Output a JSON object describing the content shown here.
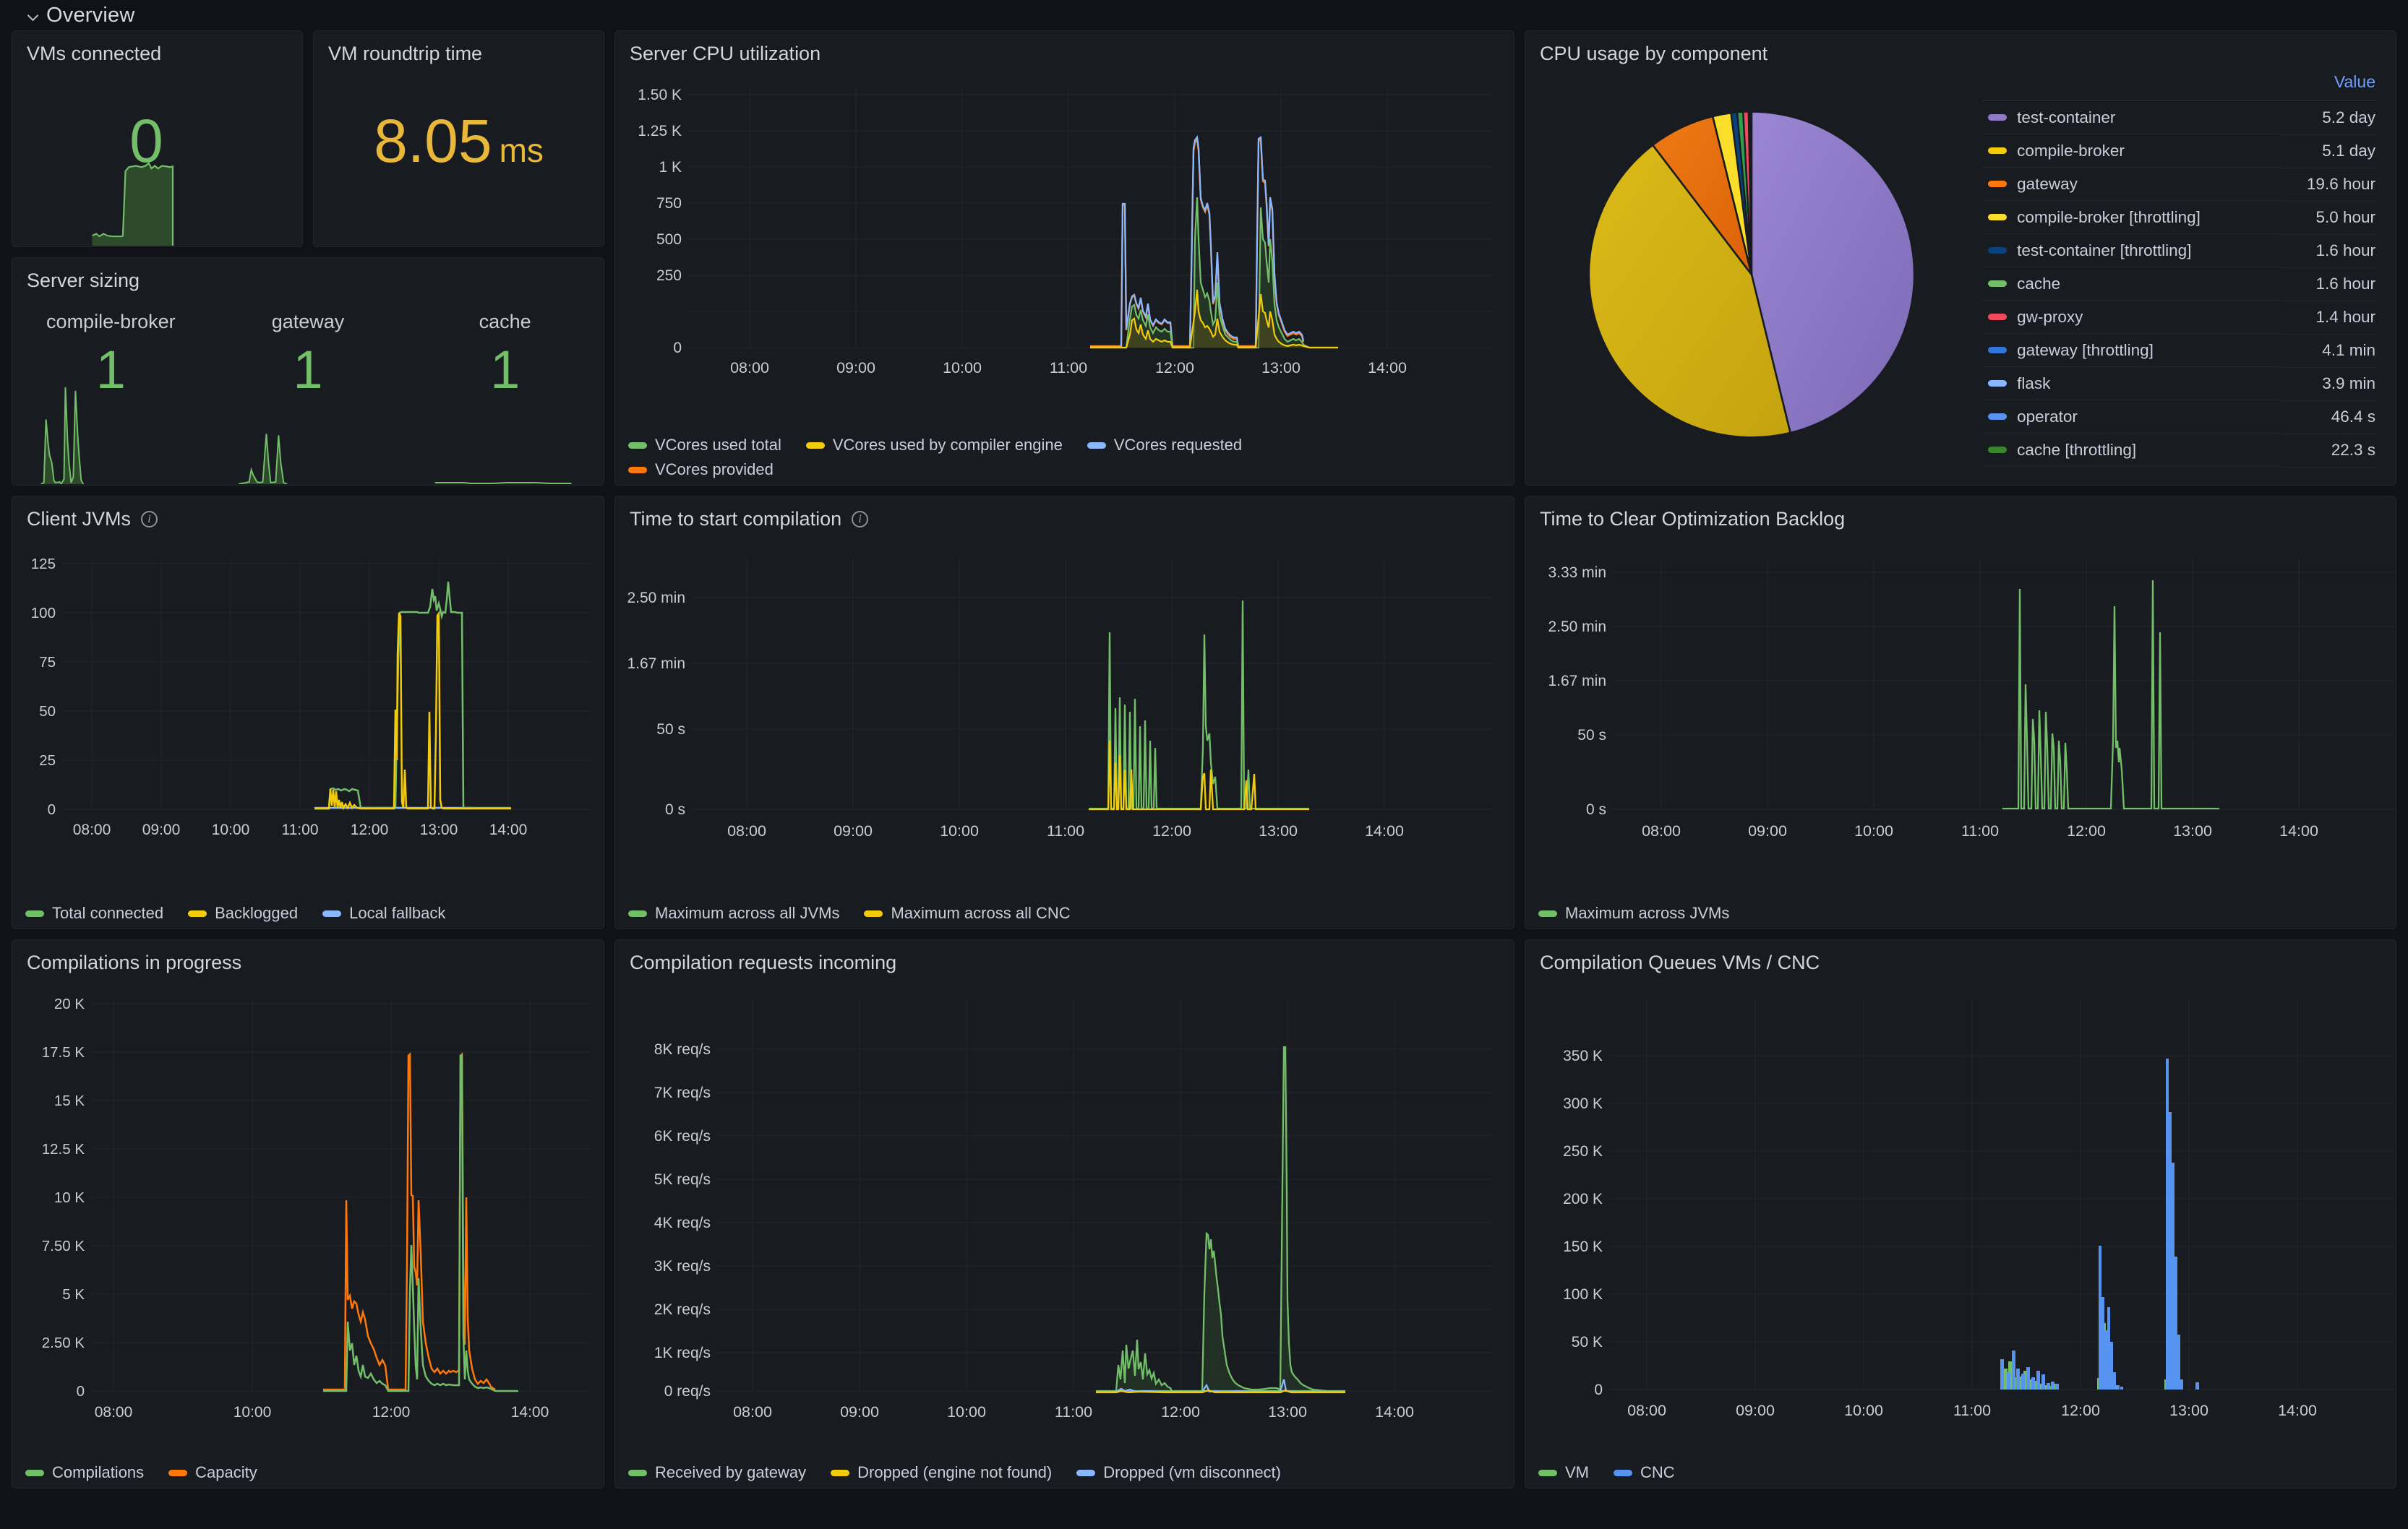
{
  "row": {
    "title": "Overview",
    "collapse_icon": "chevron-down-icon"
  },
  "colors": {
    "green": "#73bf69",
    "yellow": "#f2cc0c",
    "orange": "#ff780a",
    "blue": "#5794f2",
    "lightblue": "#8ab8ff",
    "darkblue": "#1f60c4",
    "red": "#f2495c",
    "purple": "#8f7ac7",
    "darkgold": "#cfae13",
    "semidark_green": "#37872d",
    "accent_blue": "#6e9fff",
    "panel_bg": "#181b1f",
    "page_bg": "#111217"
  },
  "panels": {
    "vms_connected": {
      "title": "VMs connected",
      "value": "0",
      "value_color": "#73bf69"
    },
    "vm_roundtrip": {
      "title": "VM roundtrip time",
      "value": "8.05",
      "unit": "ms",
      "value_color": "#eab839"
    },
    "server_sizing": {
      "title": "Server sizing",
      "items": [
        {
          "name": "compile-broker",
          "value": "1"
        },
        {
          "name": "gateway",
          "value": "1"
        },
        {
          "name": "cache",
          "value": "1"
        }
      ]
    },
    "server_cpu": {
      "title": "Server CPU utilization",
      "legend": [
        {
          "label": "VCores used total",
          "color": "#73bf69"
        },
        {
          "label": "VCores used by compiler engine",
          "color": "#f2cc0c"
        },
        {
          "label": "VCores requested",
          "color": "#8ab8ff"
        },
        {
          "label": "VCores provided",
          "color": "#ff780a"
        }
      ]
    },
    "cpu_by_component": {
      "title": "CPU usage by component",
      "value_header": "Value",
      "rows": [
        {
          "name": "test-container",
          "value": "5.2 day",
          "color": "#8f7ac7"
        },
        {
          "name": "compile-broker",
          "value": "5.1 day",
          "color": "#f2cc0c"
        },
        {
          "name": "gateway",
          "value": "19.6 hour",
          "color": "#ff780a"
        },
        {
          "name": "compile-broker [throttling]",
          "value": "5.0 hour",
          "color": "#fade2a"
        },
        {
          "name": "test-container [throttling]",
          "value": "1.6 hour",
          "color": "#0a437c"
        },
        {
          "name": "cache",
          "value": "1.6 hour",
          "color": "#73bf69"
        },
        {
          "name": "gw-proxy",
          "value": "1.4 hour",
          "color": "#f2495c"
        },
        {
          "name": "gateway [throttling]",
          "value": "4.1 min",
          "color": "#3274d9"
        },
        {
          "name": "flask",
          "value": "3.9 min",
          "color": "#8ab8ff"
        },
        {
          "name": "operator",
          "value": "46.4 s",
          "color": "#5794f2"
        },
        {
          "name": "cache [throttling]",
          "value": "22.3 s",
          "color": "#37872d"
        }
      ]
    },
    "client_jvms": {
      "title": "Client JVMs",
      "has_info": true,
      "legend": [
        {
          "label": "Total connected",
          "color": "#73bf69"
        },
        {
          "label": "Backlogged",
          "color": "#f2cc0c"
        },
        {
          "label": "Local fallback",
          "color": "#8ab8ff"
        }
      ]
    },
    "time_to_start": {
      "title": "Time to start compilation",
      "has_info": true,
      "legend": [
        {
          "label": "Maximum across all JVMs",
          "color": "#73bf69"
        },
        {
          "label": "Maximum across all CNC",
          "color": "#f2cc0c"
        }
      ]
    },
    "time_to_clear": {
      "title": "Time to Clear Optimization Backlog",
      "legend": [
        {
          "label": "Maximum across JVMs",
          "color": "#73bf69"
        }
      ]
    },
    "compilations_in_progress": {
      "title": "Compilations in progress",
      "legend": [
        {
          "label": "Compilations",
          "color": "#73bf69"
        },
        {
          "label": "Capacity",
          "color": "#ff780a"
        }
      ]
    },
    "requests_incoming": {
      "title": "Compilation requests incoming",
      "legend": [
        {
          "label": "Received by gateway",
          "color": "#73bf69"
        },
        {
          "label": "Dropped (engine not found)",
          "color": "#f2cc0c"
        },
        {
          "label": "Dropped (vm disconnect)",
          "color": "#8ab8ff"
        }
      ]
    },
    "queues": {
      "title": "Compilation Queues VMs / CNC",
      "legend": [
        {
          "label": "VM",
          "color": "#73bf69"
        },
        {
          "label": "CNC",
          "color": "#5794f2"
        }
      ]
    }
  },
  "chart_data": [
    {
      "id": "server_cpu",
      "type": "line",
      "title": "Server CPU utilization",
      "xlabel": "",
      "ylabel": "",
      "xticks": [
        "08:00",
        "09:00",
        "10:00",
        "11:00",
        "12:00",
        "13:00",
        "14:00"
      ],
      "yticks": [
        "0",
        "250",
        "500",
        "750",
        "1 K",
        "1.25 K",
        "1.50 K"
      ],
      "ylim": [
        0,
        1500
      ],
      "grid": true,
      "legend_position": "bottom",
      "series": [
        {
          "name": "VCores used total",
          "color": "#73bf69",
          "peak": 870
        },
        {
          "name": "VCores used by compiler engine",
          "color": "#f2cc0c",
          "peak": 400
        },
        {
          "name": "VCores requested",
          "color": "#8ab8ff",
          "peak": 1330
        },
        {
          "name": "VCores provided",
          "color": "#ff780a",
          "peak": 1320
        }
      ]
    },
    {
      "id": "cpu_by_component",
      "type": "pie",
      "title": "CPU usage by component",
      "labels": [
        "test-container",
        "compile-broker",
        "gateway",
        "compile-broker [throttling]",
        "test-container [throttling]",
        "cache",
        "gw-proxy",
        "gateway [throttling]",
        "flask",
        "operator",
        "cache [throttling]"
      ],
      "values": [
        5.2,
        5.1,
        0.817,
        0.208,
        0.067,
        0.067,
        0.058,
        0.00285,
        0.00271,
        0.000537,
        0.000258
      ],
      "value_labels": [
        "5.2 day",
        "5.1 day",
        "19.6 hour",
        "5.0 hour",
        "1.6 hour",
        "1.6 hour",
        "1.4 hour",
        "4.1 min",
        "3.9 min",
        "46.4 s",
        "22.3 s"
      ],
      "unit": "day",
      "colors": [
        "#8f7ac7",
        "#cfae13",
        "#e8690b",
        "#fade2a",
        "#0a437c",
        "#2f9e4f",
        "#f2495c",
        "#3274d9",
        "#8ab8ff",
        "#5794f2",
        "#37872d"
      ],
      "legend_position": "right"
    },
    {
      "id": "client_jvms",
      "type": "line",
      "title": "Client JVMs",
      "xticks": [
        "08:00",
        "09:00",
        "10:00",
        "11:00",
        "12:00",
        "13:00",
        "14:00"
      ],
      "yticks": [
        "0",
        "25",
        "50",
        "75",
        "100",
        "125"
      ],
      "ylim": [
        0,
        125
      ],
      "grid": true,
      "series": [
        {
          "name": "Total connected",
          "color": "#73bf69",
          "peak": 116
        },
        {
          "name": "Backlogged",
          "color": "#f2cc0c",
          "peak": 100
        },
        {
          "name": "Local fallback",
          "color": "#8ab8ff",
          "peak": 1
        }
      ]
    },
    {
      "id": "time_to_start",
      "type": "line",
      "title": "Time to start compilation",
      "xticks": [
        "08:00",
        "09:00",
        "10:00",
        "11:00",
        "12:00",
        "13:00",
        "14:00"
      ],
      "yticks": [
        "0 s",
        "50 s",
        "1.67 min",
        "2.50 min"
      ],
      "ylim": [
        0,
        180
      ],
      "grid": true,
      "series": [
        {
          "name": "Maximum across all JVMs",
          "color": "#73bf69",
          "peak": 167
        },
        {
          "name": "Maximum across all CNC",
          "color": "#f2cc0c",
          "peak": 55
        }
      ]
    },
    {
      "id": "time_to_clear",
      "type": "line",
      "title": "Time to Clear Optimization Backlog",
      "xticks": [
        "08:00",
        "09:00",
        "10:00",
        "11:00",
        "12:00",
        "13:00",
        "14:00"
      ],
      "yticks": [
        "0 s",
        "50 s",
        "1.67 min",
        "2.50 min",
        "3.33 min"
      ],
      "ylim": [
        0,
        220
      ],
      "grid": true,
      "series": [
        {
          "name": "Maximum across JVMs",
          "color": "#73bf69",
          "peak": 192
        }
      ]
    },
    {
      "id": "compilations_in_progress",
      "type": "line",
      "title": "Compilations in progress",
      "xticks": [
        "08:00",
        "10:00",
        "12:00",
        "14:00"
      ],
      "yticks": [
        "0",
        "2.50 K",
        "5 K",
        "7.50 K",
        "10 K",
        "12.5 K",
        "15 K",
        "17.5 K",
        "20 K"
      ],
      "ylim": [
        0,
        20000
      ],
      "grid": true,
      "series": [
        {
          "name": "Compilations",
          "color": "#73bf69",
          "peak": 17800
        },
        {
          "name": "Capacity",
          "color": "#ff780a",
          "peak": 17900
        }
      ]
    },
    {
      "id": "requests_incoming",
      "type": "area",
      "title": "Compilation requests incoming",
      "xticks": [
        "08:00",
        "09:00",
        "10:00",
        "11:00",
        "12:00",
        "13:00",
        "14:00"
      ],
      "yticks": [
        "0 req/s",
        "1K req/s",
        "2K req/s",
        "3K req/s",
        "4K req/s",
        "5K req/s",
        "6K req/s",
        "7K req/s",
        "8K req/s"
      ],
      "ylim": [
        0,
        8500
      ],
      "grid": true,
      "series": [
        {
          "name": "Received by gateway",
          "color": "#73bf69",
          "peak": 8050
        },
        {
          "name": "Dropped (engine not found)",
          "color": "#f2cc0c",
          "peak": 80
        },
        {
          "name": "Dropped (vm disconnect)",
          "color": "#8ab8ff",
          "peak": 200
        }
      ]
    },
    {
      "id": "queues",
      "type": "bar",
      "title": "Compilation Queues VMs / CNC",
      "xticks": [
        "08:00",
        "09:00",
        "10:00",
        "11:00",
        "12:00",
        "13:00",
        "14:00"
      ],
      "yticks": [
        "0",
        "50 K",
        "100 K",
        "150 K",
        "200 K",
        "250 K",
        "300 K",
        "350 K"
      ],
      "ylim": [
        0,
        380000
      ],
      "grid": true,
      "series": [
        {
          "name": "VM",
          "color": "#73bf69",
          "peak": 176000
        },
        {
          "name": "CNC",
          "color": "#5794f2",
          "peak": 351000
        }
      ]
    }
  ]
}
